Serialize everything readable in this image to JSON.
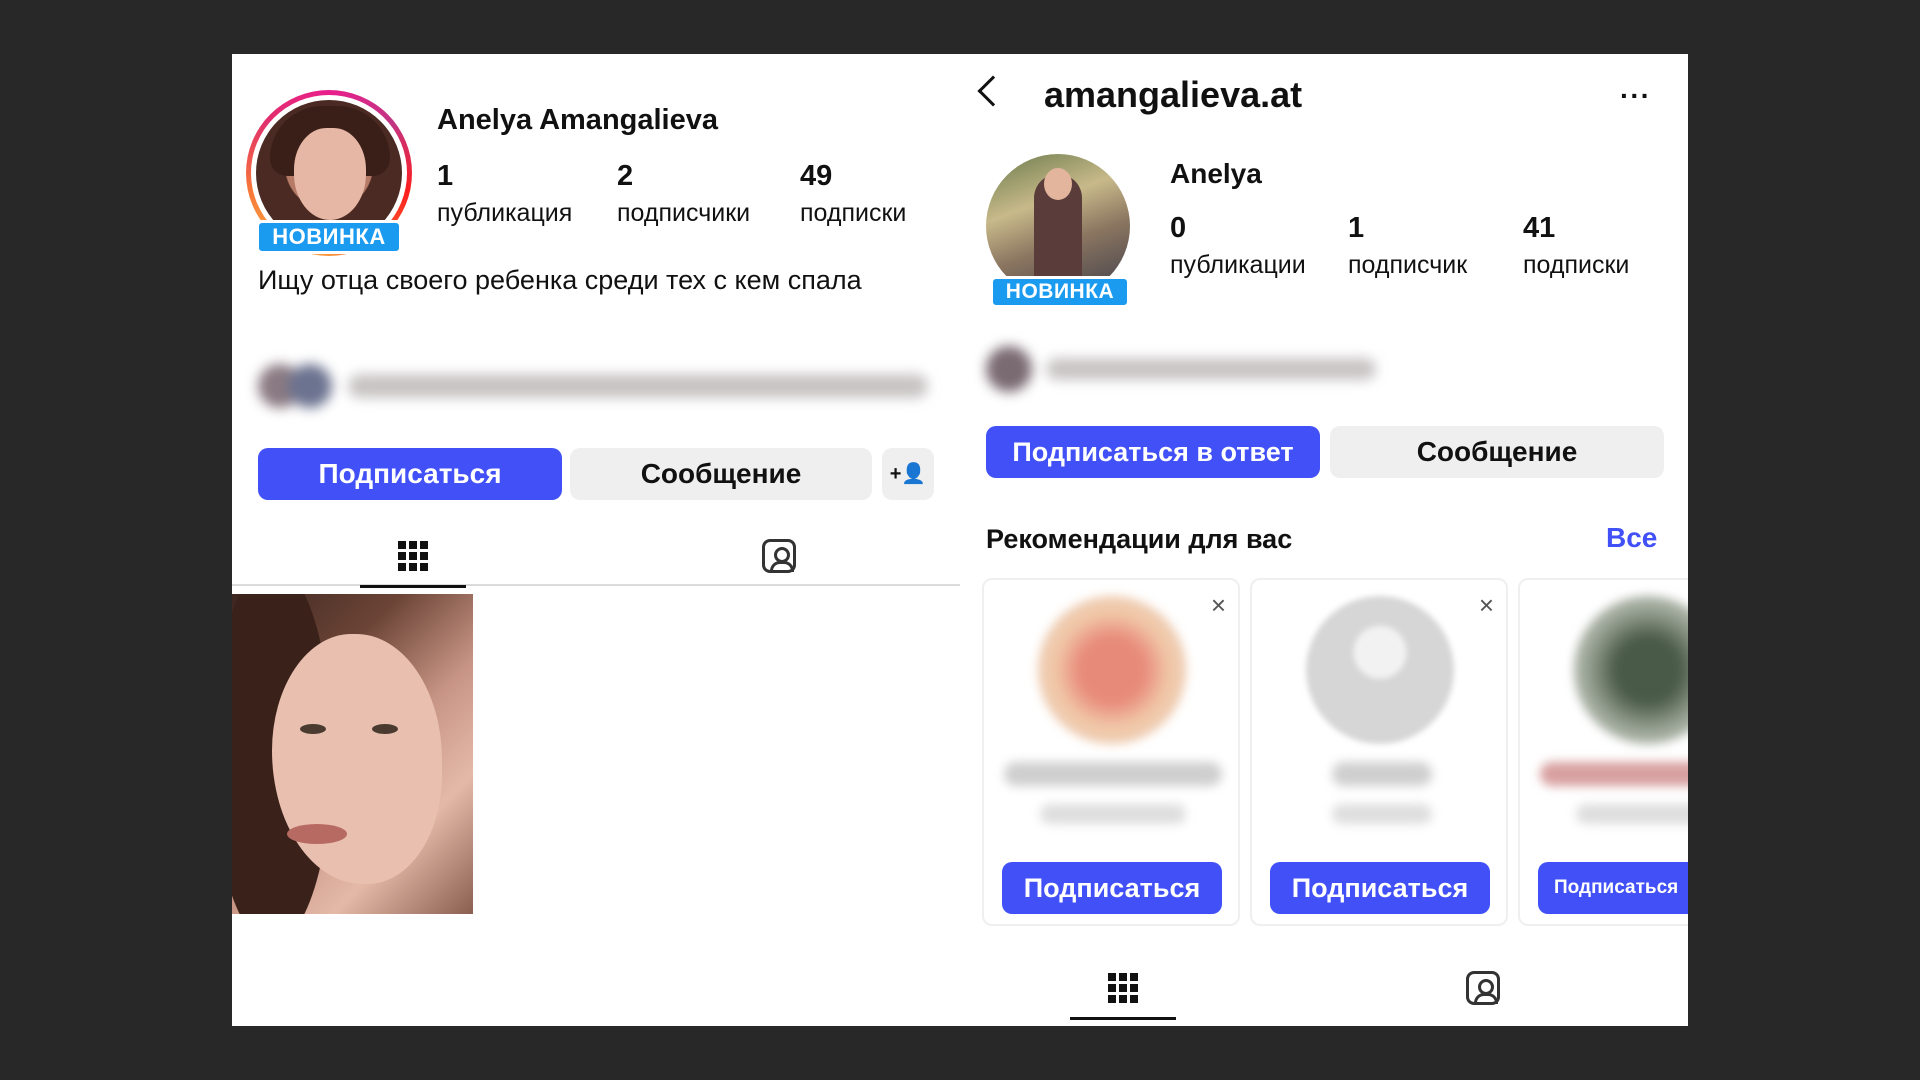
{
  "left_profile": {
    "display_name": "Anelya Amangalieva",
    "badge": "НОВИНКА",
    "stats": [
      {
        "value": "1",
        "label": "публикация"
      },
      {
        "value": "2",
        "label": "подписчики"
      },
      {
        "value": "49",
        "label": "подписки"
      }
    ],
    "bio": "Ищу отца своего ребенка среди тех с кем спала",
    "follow_label": "Подписаться",
    "message_label": "Сообщение",
    "add_user_label": "+👤"
  },
  "right_profile": {
    "username": "amangalieva.at",
    "more_label": "···",
    "display_name": "Anelya",
    "badge": "НОВИНКА",
    "stats": [
      {
        "value": "0",
        "label": "публикации"
      },
      {
        "value": "1",
        "label": "подписчик"
      },
      {
        "value": "41",
        "label": "подписки"
      }
    ],
    "follow_back_label": "Подписаться в ответ",
    "message_label": "Сообщение",
    "recommendations": {
      "title": "Рекомендации для вас",
      "see_all": "Все",
      "close_label": "×",
      "cards": [
        {
          "button": "Подписаться"
        },
        {
          "button": "Подписаться"
        },
        {
          "button": "Подписаться"
        }
      ]
    }
  },
  "icons": {
    "grid": "grid-icon",
    "tagged": "tagged-icon",
    "back": "back-arrow-icon",
    "more": "more-icon",
    "add_user": "add-user-icon",
    "close": "close-icon"
  },
  "colors": {
    "background": "#282828",
    "primary_button": "#4150f7",
    "badge": "#1a9bf0",
    "secondary_button": "#efefef"
  }
}
